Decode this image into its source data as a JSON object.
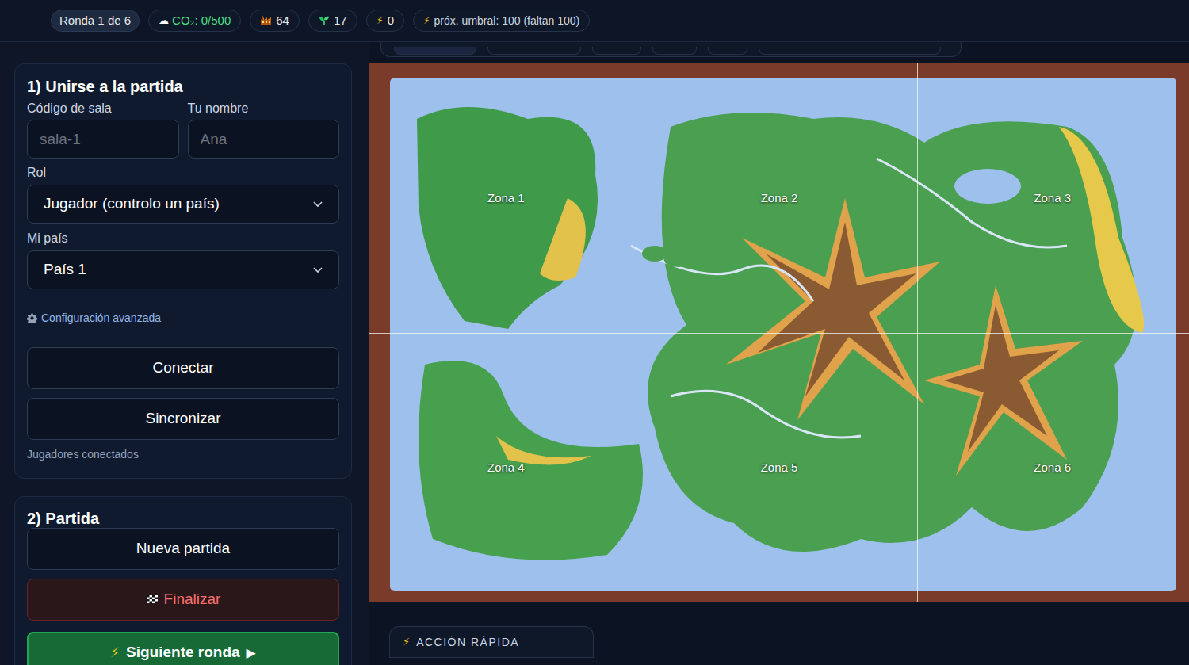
{
  "header": {
    "round": {
      "label": "Ronda 1 de 6"
    },
    "co2": {
      "glyph": "☁",
      "label": "CO₂: 0/500"
    },
    "factories": {
      "label": "64"
    },
    "plants": {
      "label": "17"
    },
    "energy": {
      "glyph": "⚡",
      "label": "0"
    },
    "threshold": {
      "glyph": "⚡",
      "label": "próx. umbral: 100 (faltan 100)"
    }
  },
  "join_panel": {
    "title": "1) Unirse a la partida",
    "room_code": {
      "label": "Código de sala",
      "placeholder": "sala-1"
    },
    "player_name": {
      "label": "Tu nombre",
      "placeholder": "Ana"
    },
    "role": {
      "label": "Rol",
      "value": "Jugador (controlo un país)"
    },
    "country": {
      "label": "Mi país",
      "value": "País 1"
    },
    "advanced_link": "Configuración avanzada",
    "buttons": [
      "Conectar",
      "Sincronizar"
    ],
    "connected_players": "Jugadores conectados"
  },
  "game_panel": {
    "title": "2) Partida",
    "new_game": "Nueva partida",
    "finish": "Finalizar",
    "next_round": {
      "glyph_before": "⚡",
      "label": "Siguiente ronda",
      "glyph_after": "▶"
    }
  },
  "map": {
    "zones": [
      {
        "label": "Zona 1"
      },
      {
        "label": "Zona 2"
      },
      {
        "label": "Zona 3"
      },
      {
        "label": "Zona 4"
      },
      {
        "label": "Zona 5"
      },
      {
        "label": "Zona 6"
      }
    ]
  },
  "quick_action": {
    "glyph": "⚡",
    "title": "ACCIÓN RÁPIDA"
  }
}
